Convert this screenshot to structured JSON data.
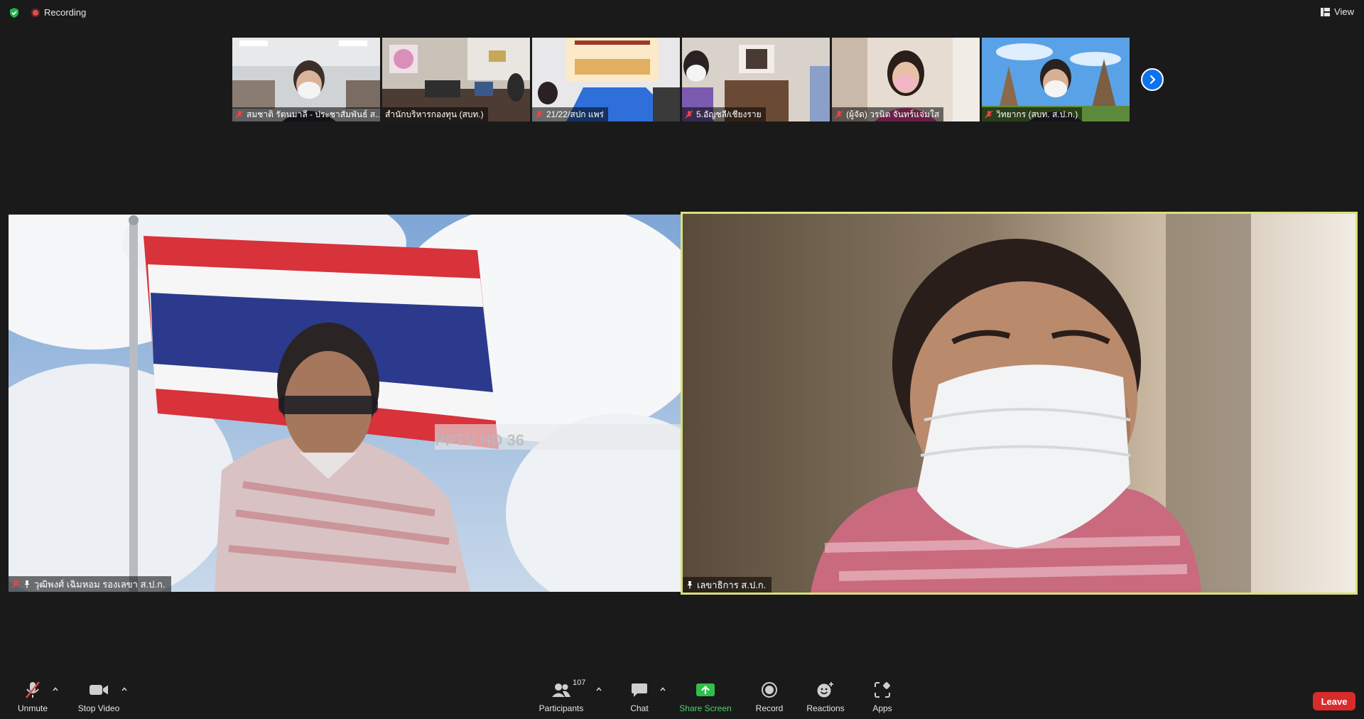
{
  "status": {
    "recording_label": "Recording",
    "view_label": "View"
  },
  "thumbnails": [
    {
      "label": "สมชาติ รัตนมาลี - ประชาสัมพันธ์ ส..."
    },
    {
      "label": "สำนักบริหารกองทุน (สบท.)"
    },
    {
      "label": "21/22/สปก แพร่"
    },
    {
      "label": "5.อัญชลี/เชียงราย"
    },
    {
      "label": "(ผู้จัด) วรนิต จันทร์แจ่มใส"
    },
    {
      "label": "วิทยากร (สบท. ส.ป.ก.)"
    }
  ],
  "tiles": {
    "left_label": "วุฒิพงศ์ เฉิมหอม รองเลขา ส.ป.ก.",
    "left_watermark": "PPTV HD 36",
    "right_label": "เลขาธิการ ส.ป.ก."
  },
  "toolbar": {
    "unmute_label": "Unmute",
    "stop_video_label": "Stop Video",
    "participants_label": "Participants",
    "participants_count": "107",
    "chat_label": "Chat",
    "share_label": "Share Screen",
    "record_label": "Record",
    "reactions_label": "Reactions",
    "apps_label": "Apps",
    "leave_label": "Leave"
  },
  "colors": {
    "background": "#1a1a1a",
    "active_speaker_border": "#d9e07a",
    "share_green": "#4fd16a",
    "leave_red": "#d82c2c",
    "next_blue": "#0e72ed"
  }
}
